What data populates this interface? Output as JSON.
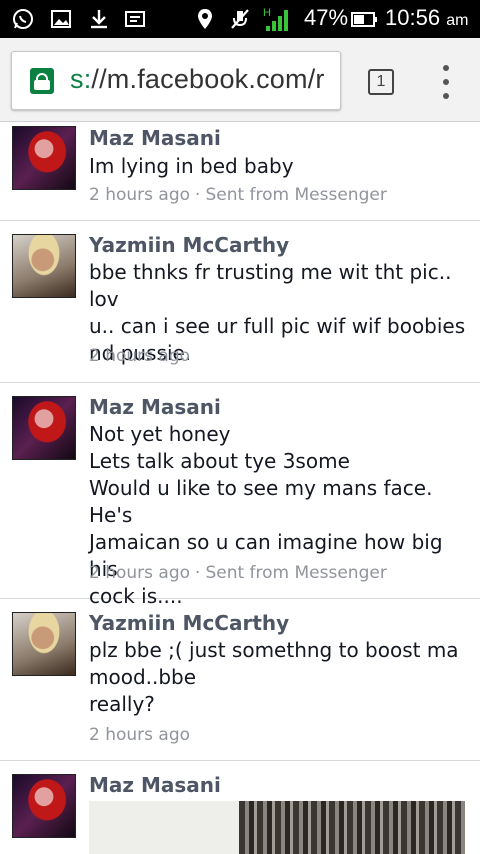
{
  "status_bar": {
    "icons": [
      "whatsapp-icon",
      "gallery-icon",
      "download-icon",
      "message-icon",
      "location-icon",
      "mute-icon",
      "signal-icon",
      "battery-icon"
    ],
    "network_type": "H",
    "battery_percent": "47%",
    "time": "10:56",
    "ampm": "am"
  },
  "browser": {
    "url_scheme": "s:",
    "url_rest": "//m.facebook.com/r",
    "tab_count": "1"
  },
  "messages": [
    {
      "sender": "Maz Masani",
      "text": "Im lying in bed baby",
      "time": "2 hours ago",
      "source": "Sent from Messenger"
    },
    {
      "sender": "Yazmiin McCarthy",
      "text": "bbe thnks fr trusting me wit tht pic.. lov\nu.. can i see ur full pic wif wif boobies\nnd pussie.",
      "time": "2 hours ago"
    },
    {
      "sender": "Maz Masani",
      "text": "Not yet honey\nLets talk about tye 3some\nWould u like to see my mans face. He's\nJamaican so u can imagine how big his\ncock is....",
      "time": "2 hours ago",
      "source": "Sent from Messenger"
    },
    {
      "sender": "Yazmiin McCarthy",
      "text": "plz bbe ;( just somethng to boost ma\nmood..bbe\nreally?",
      "time": "2 hours ago"
    },
    {
      "sender": "Maz Masani"
    }
  ],
  "colors": {
    "sender": "#4e5665",
    "body": "#141823",
    "meta": "#90949c",
    "secure": "#0b8043"
  }
}
